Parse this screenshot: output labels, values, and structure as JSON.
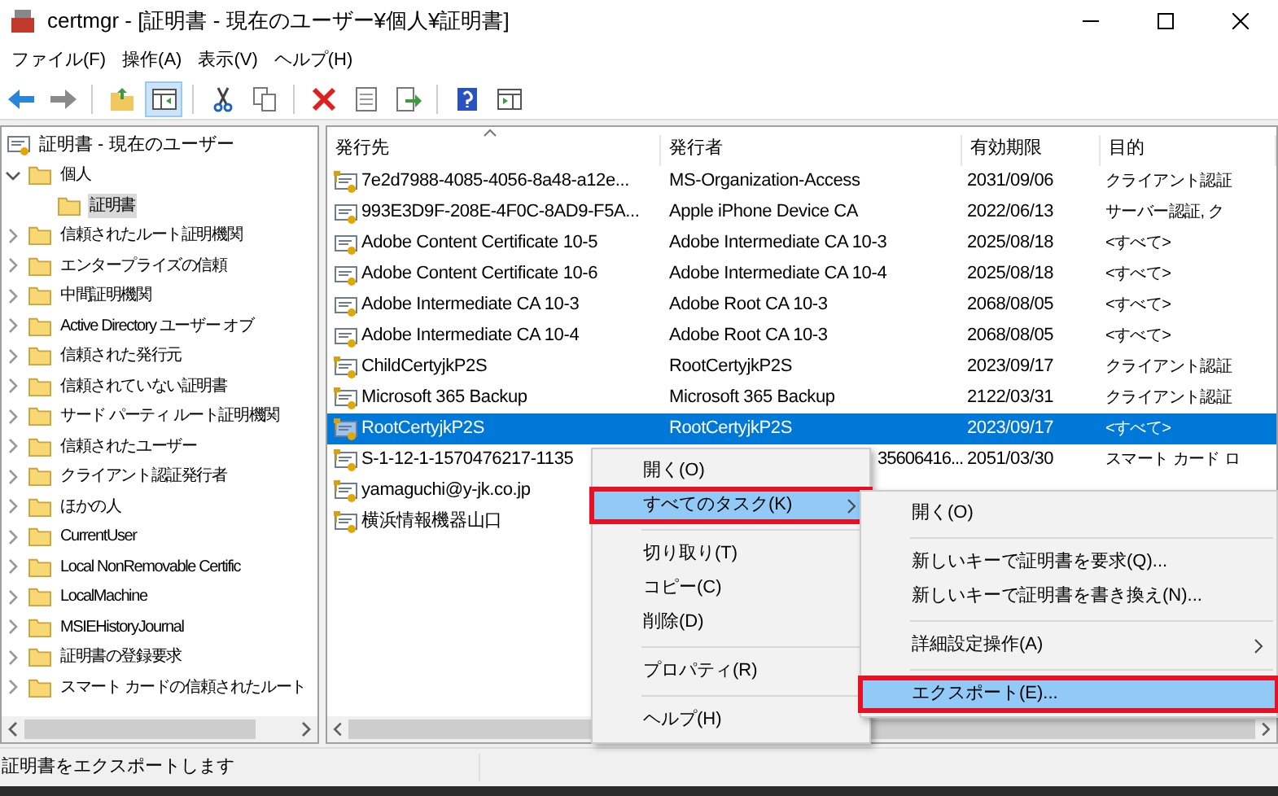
{
  "window": {
    "title": "certmgr - [証明書 - 現在のユーザー¥個人¥証明書]"
  },
  "menu_bar": [
    "ファイル(F)",
    "操作(A)",
    "表示(V)",
    "ヘルプ(H)"
  ],
  "toolbar": [
    {
      "kind": "back",
      "pressed": false
    },
    {
      "kind": "forward",
      "pressed": false
    },
    {
      "kind": "sep"
    },
    {
      "kind": "up",
      "pressed": false
    },
    {
      "kind": "tree",
      "pressed": true
    },
    {
      "kind": "sep"
    },
    {
      "kind": "cut",
      "pressed": false
    },
    {
      "kind": "copy",
      "pressed": false
    },
    {
      "kind": "sep"
    },
    {
      "kind": "delete",
      "pressed": false
    },
    {
      "kind": "properties",
      "pressed": false
    },
    {
      "kind": "export",
      "pressed": false
    },
    {
      "kind": "sep"
    },
    {
      "kind": "help",
      "pressed": false
    },
    {
      "kind": "pane",
      "pressed": false
    }
  ],
  "tree": {
    "label": "証明書 - 現在のユーザー",
    "children": [
      {
        "label": "個人",
        "expanded": true,
        "selected": false,
        "children": [
          {
            "label": "証明書",
            "selected": true
          }
        ]
      },
      {
        "label": "信頼されたルート証明機関",
        "expanded": false,
        "selected": false
      },
      {
        "label": "エンタープライズの信頼",
        "expanded": false,
        "selected": false
      },
      {
        "label": "中間証明機関",
        "expanded": false,
        "selected": false
      },
      {
        "label": "Active Directory ユーザー オブ",
        "expanded": false,
        "selected": false
      },
      {
        "label": "信頼された発行元",
        "expanded": false,
        "selected": false
      },
      {
        "label": "信頼されていない証明書",
        "expanded": false,
        "selected": false
      },
      {
        "label": "サード パーティ ルート証明機関",
        "expanded": false,
        "selected": false
      },
      {
        "label": "信頼されたユーザー",
        "expanded": false,
        "selected": false
      },
      {
        "label": "クライアント認証発行者",
        "expanded": false,
        "selected": false
      },
      {
        "label": "ほかの人",
        "expanded": false,
        "selected": false
      },
      {
        "label": "CurrentUser",
        "expanded": false,
        "selected": false
      },
      {
        "label": "Local NonRemovable Certific",
        "expanded": false,
        "selected": false
      },
      {
        "label": "LocalMachine",
        "expanded": false,
        "selected": false
      },
      {
        "label": "MSIEHistoryJournal",
        "expanded": false,
        "selected": false
      },
      {
        "label": "証明書の登録要求",
        "expanded": false,
        "selected": false
      },
      {
        "label": "スマート カードの信頼されたルート",
        "expanded": false,
        "selected": false
      }
    ]
  },
  "table": {
    "columns": [
      "発行先",
      "発行者",
      "有効期限",
      "目的"
    ],
    "rows": [
      {
        "issued_to": "7e2d7988-4085-4056-8a48-a12e...",
        "issuer": "MS-Organization-Access",
        "expires": "2031/09/06",
        "purpose": "クライアント認証",
        "has_key": true,
        "selected": false
      },
      {
        "issued_to": "993E3D9F-208E-4F0C-8AD9-F5A...",
        "issuer": "Apple iPhone Device CA",
        "expires": "2022/06/13",
        "purpose": "サーバー認証, ク",
        "has_key": false,
        "selected": false
      },
      {
        "issued_to": "Adobe Content Certificate 10-5",
        "issuer": "Adobe Intermediate CA 10-3",
        "expires": "2025/08/18",
        "purpose": "<すべて>",
        "has_key": false,
        "selected": false
      },
      {
        "issued_to": "Adobe Content Certificate 10-6",
        "issuer": "Adobe Intermediate CA 10-4",
        "expires": "2025/08/18",
        "purpose": "<すべて>",
        "has_key": false,
        "selected": false
      },
      {
        "issued_to": "Adobe Intermediate CA 10-3",
        "issuer": "Adobe Root CA 10-3",
        "expires": "2068/08/05",
        "purpose": "<すべて>",
        "has_key": false,
        "selected": false
      },
      {
        "issued_to": "Adobe Intermediate CA 10-4",
        "issuer": "Adobe Root CA 10-3",
        "expires": "2068/08/05",
        "purpose": "<すべて>",
        "has_key": false,
        "selected": false
      },
      {
        "issued_to": "ChildCertyjkP2S",
        "issuer": "RootCertyjkP2S",
        "expires": "2023/09/17",
        "purpose": "クライアント認証",
        "has_key": true,
        "selected": false
      },
      {
        "issued_to": "Microsoft 365 Backup",
        "issuer": "Microsoft 365 Backup",
        "expires": "2122/03/31",
        "purpose": "クライアント認証",
        "has_key": true,
        "selected": false
      },
      {
        "issued_to": "RootCertyjkP2S",
        "issuer": "RootCertyjkP2S",
        "expires": "2023/09/17",
        "purpose": "<すべて>",
        "has_key": true,
        "selected": true
      },
      {
        "issued_to": "S-1-12-1-1570476217-1135",
        "issuer": "35606416...",
        "issuer_clipped": true,
        "expires": "2051/03/30",
        "purpose": "スマート カード ロ",
        "has_key": true,
        "selected": false
      },
      {
        "issued_to": "yamaguchi@y-jk.co.jp",
        "has_key": true,
        "selected": false
      },
      {
        "issued_to": "横浜情報機器山口",
        "has_key": true,
        "selected": false
      }
    ]
  },
  "context_menu": [
    {
      "kind": "item",
      "label": "開く(O)",
      "selected": false,
      "annotated": false
    },
    {
      "kind": "submenu",
      "label": "すべてのタスク(K)",
      "selected": true,
      "annotated": true
    },
    {
      "kind": "sep"
    },
    {
      "kind": "item",
      "label": "切り取り(T)",
      "selected": false,
      "annotated": false
    },
    {
      "kind": "item",
      "label": "コピー(C)",
      "selected": false,
      "annotated": false
    },
    {
      "kind": "item",
      "label": "削除(D)",
      "selected": false,
      "annotated": false
    },
    {
      "kind": "sep"
    },
    {
      "kind": "item",
      "label": "プロパティ(R)",
      "selected": false,
      "annotated": false
    },
    {
      "kind": "sep"
    },
    {
      "kind": "item",
      "label": "ヘルプ(H)",
      "selected": false,
      "annotated": false
    }
  ],
  "submenu": [
    {
      "kind": "item",
      "label": "開く(O)",
      "selected": false,
      "annotated": false
    },
    {
      "kind": "sep"
    },
    {
      "kind": "item",
      "label": "新しいキーで証明書を要求(Q)...",
      "selected": false,
      "annotated": false
    },
    {
      "kind": "item",
      "label": "新しいキーで証明書を書き換え(N)...",
      "selected": false,
      "annotated": false
    },
    {
      "kind": "sep"
    },
    {
      "kind": "submenu",
      "label": "詳細設定操作(A)",
      "selected": false,
      "annotated": false
    },
    {
      "kind": "sep"
    },
    {
      "kind": "item",
      "label": "エクスポート(E)...",
      "selected": true,
      "annotated": true
    }
  ],
  "status_bar": "証明書をエクスポートします"
}
